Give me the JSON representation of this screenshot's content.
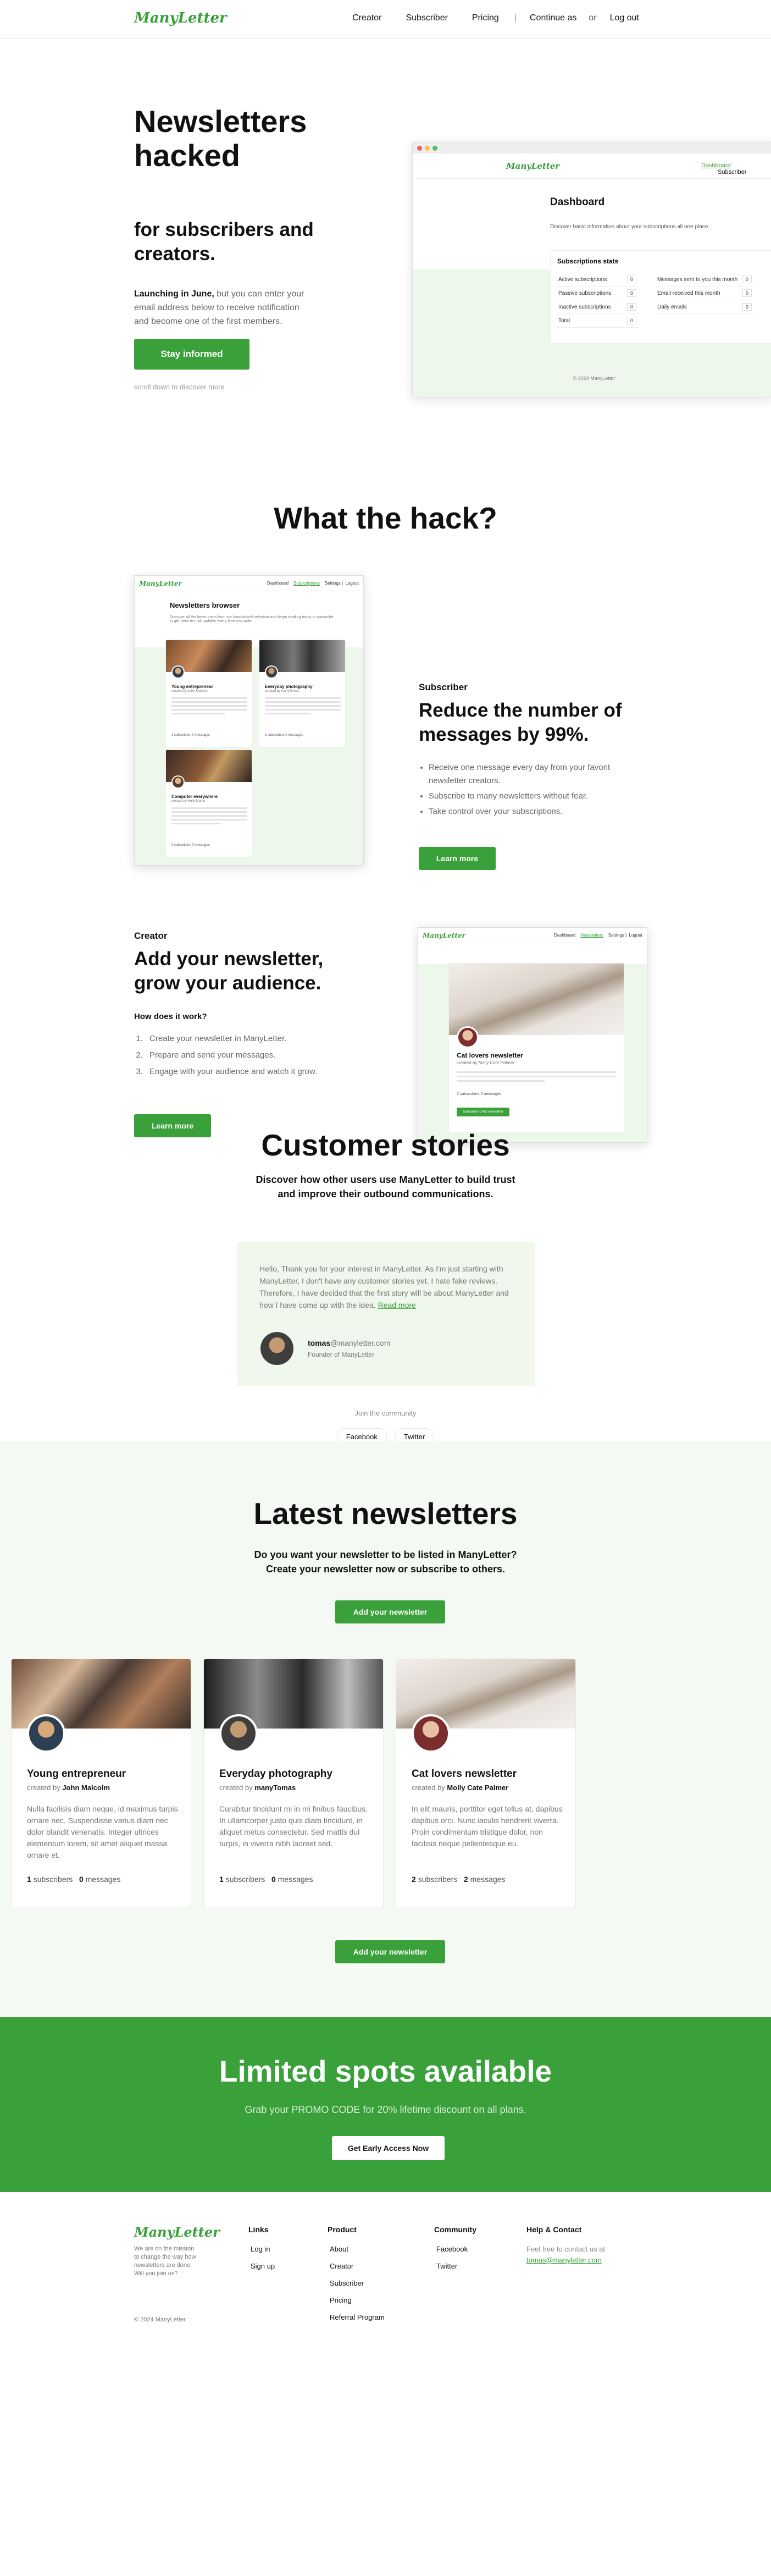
{
  "nav": {
    "logo": "ManyLetter",
    "links": [
      "Creator",
      "Subscriber",
      "Pricing"
    ],
    "separator": "|",
    "continue_as": "Continue as",
    "or": "or",
    "logout": "Log out"
  },
  "hero": {
    "title": "Newsletters hacked",
    "subtitle": "for subscribers and creators.",
    "lead_bold": "Launching in June,",
    "lead_rest": " but you can enter your email address below to receive notification and become one of the first members.",
    "cta": "Stay informed",
    "scroll_hint": "scroll down to discover more"
  },
  "dashboard_mock": {
    "logo": "ManyLetter",
    "link_active": "Dashboard",
    "link_subscriber": "Subscriber",
    "title": "Dashboard",
    "description": "Discover basic information about your subscriptions all one place.",
    "stats_title": "Subscriptions stats",
    "left_stats": [
      {
        "label": "Active subscriptions",
        "value": "0"
      },
      {
        "label": "Passive subscriptions",
        "value": "0"
      },
      {
        "label": "Inactive subscriptions",
        "value": "0"
      },
      {
        "label": "Total",
        "value": "0"
      }
    ],
    "right_stats": [
      {
        "label": "Messages sent to you this month",
        "value": "0"
      },
      {
        "label": "Email received this month",
        "value": "0"
      },
      {
        "label": "Daily emails",
        "value": "0"
      }
    ],
    "footer": "© 2024 ManyLetter"
  },
  "hack": {
    "title": "What the hack?",
    "browser_mock": {
      "logo": "ManyLetter",
      "links": [
        "Dashboard",
        "Subscriptions",
        "Settings",
        "Logout"
      ],
      "title": "Newsletters browser",
      "description": "Discover all the latest posts from our handpicked selection and begin reading today or subscribe to get fresh in-mail updates every time you write.",
      "cards": [
        {
          "title": "Young entrepreneur",
          "creator": "created by John Malcolm",
          "stats": "1 subscribers  0 messages"
        },
        {
          "title": "Everyday photography",
          "creator": "created by manyTomas",
          "stats": "1 subscribers  0 messages"
        },
        {
          "title": "Computer everywhere",
          "creator": "created by Holly Martin",
          "stats": "0 subscribers  0 messages"
        }
      ]
    },
    "subscriber": {
      "kicker": "Subscriber",
      "title": "Reduce the number of messages by 99%.",
      "points": [
        "Receive one message every day from your favorit newsletter creators.",
        "Subscribe to many newsletters without fear.",
        "Take control over your subscriptions."
      ],
      "cta": "Learn more"
    },
    "creator": {
      "kicker": "Creator",
      "title": "Add your newsletter, grow your audience.",
      "how": "How does it work?",
      "steps": [
        "Create your newsletter in ManyLetter.",
        "Prepare and send your messages.",
        "Engage with your audience and watch it grow."
      ],
      "cta": "Learn more"
    },
    "creator_mock": {
      "logo": "ManyLetter",
      "links": [
        "Dashboard",
        "Newsletters",
        "Settings",
        "Logout"
      ],
      "title": "Cat lovers newsletter",
      "creator": "created by Molly Cate Palmer",
      "stats": "2 subscribers  2 messages",
      "button": "Subscribe to this newsletter"
    }
  },
  "stories": {
    "title": "Customer stories",
    "subtitle": "Discover how other users use ManyLetter to build trust and improve their outbound communications.",
    "quote": "Hello, Thank you for your interest in ManyLetter. As I'm just starting with ManyLetter, I don't have any customer stories yet. I hate fake reviews. Therefore, I have decided that the first story will be about ManyLetter and how I have come up with the idea.",
    "read_more": "Read more",
    "author_name": "tomas",
    "author_domain": "@manyletter.com",
    "author_role": "Founder of ManyLetter",
    "community": "Join the community",
    "social": [
      "Facebook",
      "Twitter"
    ]
  },
  "latest": {
    "title": "Latest newsletters",
    "subtitle": "Do you want your newsletter to be listed in ManyLetter? Create your newsletter now or subscribe to others.",
    "cta": "Add your newsletter",
    "created_by": "created by",
    "cards": [
      {
        "title": "Young entrepreneur",
        "creator": "John Malcolm",
        "description": "Nulla facilisis diam neque, id maximus turpis ornare nec. Suspendisse varius diam nec dolor blandit venenatis. Integer ultrices elementum lorem, sit amet aliquet massa ornare et.",
        "subscribers": "1",
        "messages": "0"
      },
      {
        "title": "Everyday photography",
        "creator": "manyTomas",
        "description": "Curabitur tincidunt mi in mi finibus faucibus. In ullamcorper justo quis diam tincidunt, in aliquet metus consectetur. Sed mattis dui turpis, in viverra nibh laoreet sed.",
        "subscribers": "1",
        "messages": "0"
      },
      {
        "title": "Cat lovers newsletter",
        "creator": "Molly Cate Palmer",
        "description": "In elit mauris, porttitor eget tellus at, dapibus dapibus orci. Nunc iaculis hendrerit viverra. Proin condimentum tristique dolor, non facilisis neque pellentesque eu.",
        "subscribers": "2",
        "messages": "2"
      }
    ],
    "subscribers_label": "subscribers",
    "messages_label": "messages"
  },
  "limited": {
    "title": "Limited spots available",
    "subtitle": "Grab your PROMO CODE for 20% lifetime discount on all plans.",
    "cta": "Get Early Access Now"
  },
  "footer": {
    "logo": "ManyLetter",
    "tagline": "We are on the mission to change the way how newsletters are done. Will you join us?",
    "copyright": "© 2024 ManyLetter",
    "links_title": "Links",
    "links": [
      "Log in",
      "Sign up"
    ],
    "product_title": "Product",
    "product": [
      "About",
      "Creator",
      "Subscriber",
      "Pricing",
      "Referral Program"
    ],
    "community_title": "Community",
    "community": [
      "Facebook",
      "Twitter"
    ],
    "help_title": "Help & Contact",
    "help_text": "Feel free to contact us at",
    "help_email": "tomas@manyletter.com"
  },
  "colors": {
    "brand_green": "#3aa13a",
    "light_green": "#eef7ec"
  }
}
